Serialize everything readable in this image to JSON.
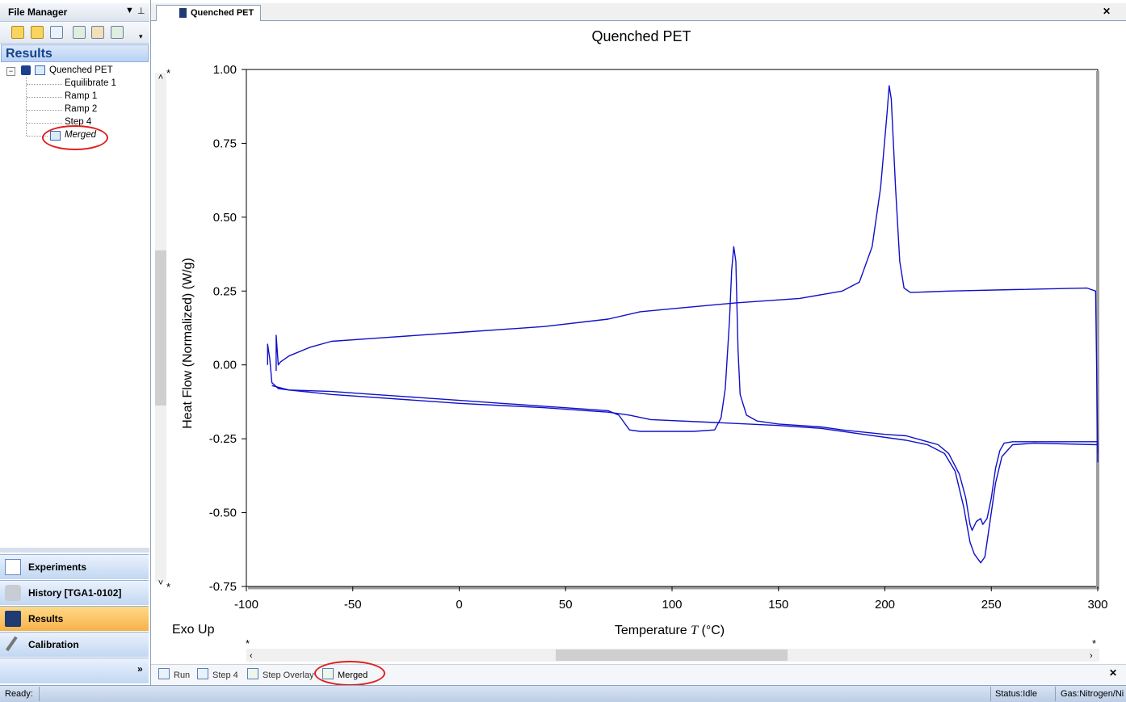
{
  "file_manager": {
    "title": "File Manager",
    "pin_icon": "pin-icon",
    "results_label": "Results",
    "tree": {
      "root": "Quenched PET",
      "children": [
        "Equilibrate 1",
        "Ramp 1",
        "Ramp 2",
        "Step 4",
        "Merged"
      ]
    },
    "nav": {
      "experiments": "Experiments",
      "history": "History [TGA1-0102]",
      "results": "Results",
      "calibration": "Calibration",
      "more": "»"
    }
  },
  "document": {
    "tab_title": "Quenched PET",
    "close": "✕"
  },
  "bottom_tabs": {
    "run": "Run",
    "step4": "Step 4",
    "step_overlay": "Step Overlay",
    "merged": "Merged"
  },
  "status": {
    "ready": "Ready:",
    "state": "Status:Idle",
    "gas": "Gas:Nitrogen/Ni"
  },
  "chart_data": {
    "type": "line",
    "title": "Quenched PET",
    "xlabel": "Temperature",
    "xlabel_symbol": "T",
    "xlabel_unit": "(°C)",
    "ylabel": "Heat Flow (Normalized)  (W/g)",
    "xlim": [
      -100,
      300
    ],
    "ylim": [
      -0.75,
      1.0
    ],
    "x_ticks": [
      -100,
      -50,
      0,
      50,
      100,
      150,
      200,
      250,
      300
    ],
    "y_ticks": [
      "1.00",
      "0.75",
      "0.50",
      "0.25",
      "0.00",
      "-0.25",
      "-0.50",
      "-0.75"
    ],
    "y_tick_values": [
      1.0,
      0.75,
      0.5,
      0.25,
      0.0,
      -0.25,
      -0.5,
      -0.75
    ],
    "annotation": "Exo Up",
    "color": "#1010c8",
    "series": [
      {
        "points": [
          [
            -90,
            0.0
          ],
          [
            -90,
            0.07
          ],
          [
            -89,
            0.02
          ],
          [
            -88,
            -0.06
          ],
          [
            -85,
            -0.08
          ],
          [
            -80,
            -0.085
          ],
          [
            -60,
            -0.09
          ],
          [
            -40,
            -0.1
          ],
          [
            -20,
            -0.11
          ],
          [
            0,
            -0.12
          ],
          [
            20,
            -0.13
          ],
          [
            40,
            -0.14
          ],
          [
            60,
            -0.15
          ],
          [
            70,
            -0.155
          ],
          [
            75,
            -0.17
          ],
          [
            78,
            -0.2
          ],
          [
            80,
            -0.22
          ],
          [
            85,
            -0.225
          ],
          [
            110,
            -0.225
          ],
          [
            120,
            -0.22
          ],
          [
            123,
            -0.18
          ],
          [
            125,
            -0.08
          ],
          [
            127,
            0.15
          ],
          [
            128,
            0.32
          ],
          [
            129,
            0.4
          ],
          [
            130,
            0.35
          ],
          [
            131,
            0.05
          ],
          [
            132,
            -0.1
          ],
          [
            135,
            -0.17
          ],
          [
            140,
            -0.19
          ],
          [
            150,
            -0.2
          ],
          [
            170,
            -0.21
          ],
          [
            180,
            -0.22
          ],
          [
            200,
            -0.235
          ],
          [
            210,
            -0.24
          ],
          [
            220,
            -0.26
          ],
          [
            225,
            -0.27
          ],
          [
            230,
            -0.3
          ],
          [
            235,
            -0.37
          ],
          [
            238,
            -0.45
          ],
          [
            240,
            -0.54
          ],
          [
            241,
            -0.56
          ],
          [
            243,
            -0.53
          ],
          [
            245,
            -0.52
          ],
          [
            246,
            -0.54
          ],
          [
            248,
            -0.52
          ],
          [
            250,
            -0.45
          ],
          [
            252,
            -0.35
          ],
          [
            254,
            -0.29
          ],
          [
            256,
            -0.265
          ],
          [
            260,
            -0.26
          ],
          [
            280,
            -0.26
          ],
          [
            300,
            -0.26
          ],
          [
            300,
            -0.33
          ]
        ]
      },
      {
        "points": [
          [
            -86,
            -0.02
          ],
          [
            -86,
            0.1
          ],
          [
            -85,
            0.0
          ],
          [
            -84,
            0.01
          ],
          [
            -80,
            0.03
          ],
          [
            -70,
            0.06
          ],
          [
            -60,
            0.08
          ],
          [
            -40,
            0.09
          ],
          [
            0,
            0.11
          ],
          [
            40,
            0.13
          ],
          [
            70,
            0.155
          ],
          [
            85,
            0.18
          ],
          [
            100,
            0.19
          ],
          [
            130,
            0.21
          ],
          [
            160,
            0.225
          ],
          [
            180,
            0.25
          ],
          [
            188,
            0.28
          ],
          [
            194,
            0.4
          ],
          [
            198,
            0.6
          ],
          [
            201,
            0.85
          ],
          [
            202,
            0.945
          ],
          [
            203,
            0.9
          ],
          [
            205,
            0.6
          ],
          [
            207,
            0.35
          ],
          [
            209,
            0.26
          ],
          [
            212,
            0.245
          ],
          [
            230,
            0.25
          ],
          [
            260,
            0.255
          ],
          [
            295,
            0.26
          ],
          [
            299,
            0.25
          ],
          [
            300,
            -0.3
          ]
        ]
      },
      {
        "points": [
          [
            -88,
            -0.07
          ],
          [
            -80,
            -0.085
          ],
          [
            -60,
            -0.1
          ],
          [
            -40,
            -0.11
          ],
          [
            0,
            -0.13
          ],
          [
            40,
            -0.145
          ],
          [
            60,
            -0.155
          ],
          [
            70,
            -0.16
          ],
          [
            80,
            -0.17
          ],
          [
            90,
            -0.185
          ],
          [
            120,
            -0.195
          ],
          [
            150,
            -0.205
          ],
          [
            170,
            -0.215
          ],
          [
            190,
            -0.235
          ],
          [
            210,
            -0.255
          ],
          [
            220,
            -0.27
          ],
          [
            228,
            -0.3
          ],
          [
            233,
            -0.36
          ],
          [
            237,
            -0.48
          ],
          [
            240,
            -0.6
          ],
          [
            242,
            -0.64
          ],
          [
            245,
            -0.67
          ],
          [
            247,
            -0.65
          ],
          [
            249,
            -0.55
          ],
          [
            252,
            -0.4
          ],
          [
            255,
            -0.31
          ],
          [
            260,
            -0.27
          ],
          [
            270,
            -0.265
          ],
          [
            300,
            -0.27
          ]
        ]
      }
    ]
  }
}
